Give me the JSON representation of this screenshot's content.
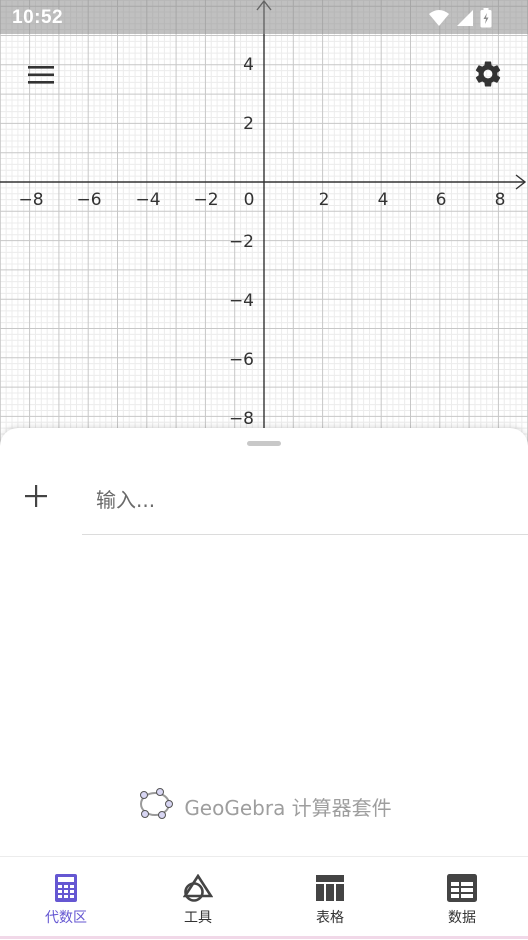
{
  "status_bar": {
    "time": "10:52"
  },
  "graph": {
    "x_tick_labels": [
      "−8",
      "−6",
      "−4",
      "−2",
      "0",
      "2",
      "4",
      "6",
      "8"
    ],
    "y_tick_labels": [
      "4",
      "2",
      "−2",
      "−4",
      "−6",
      "−8"
    ]
  },
  "algebra": {
    "input_placeholder": "输入..."
  },
  "brand": {
    "name": "GeoGebra 计算器套件"
  },
  "bottom_nav": [
    {
      "label": "代数区",
      "icon": "calculator-icon",
      "active": true
    },
    {
      "label": "工具",
      "icon": "shapes-tool-icon",
      "active": false
    },
    {
      "label": "表格",
      "icon": "table-icon",
      "active": false
    },
    {
      "label": "数据",
      "icon": "spreadsheet-icon",
      "active": false
    }
  ],
  "colors": {
    "accent": "#6557d2",
    "axis": "#333333",
    "grid_major": "#c7c7c7",
    "grid_minor": "#ececec"
  }
}
